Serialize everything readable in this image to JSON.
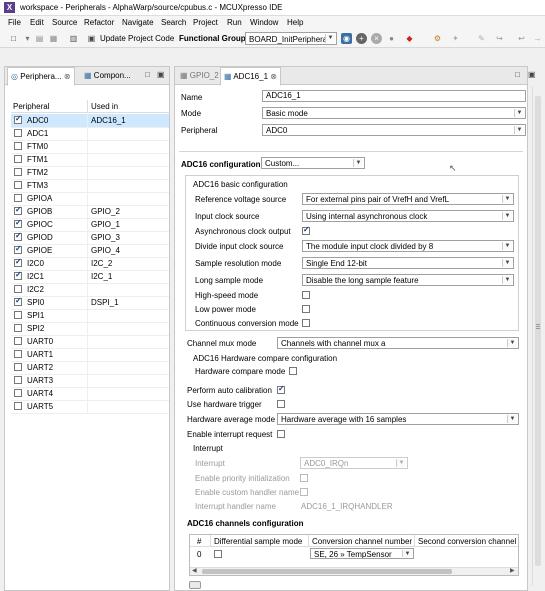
{
  "window": {
    "title": "workspace - Peripherals - AlphaWarp/source/cpubus.c - MCUXpresso IDE",
    "app_icon": "X"
  },
  "menu": [
    "File",
    "Edit",
    "Source",
    "Refactor",
    "Navigate",
    "Search",
    "Project",
    "Run",
    "Window",
    "Help"
  ],
  "toolbar": {
    "update_label": "Update Project Code",
    "group_label": "Functional Group",
    "group_value": "BOARD_InitPeripherals"
  },
  "left_tabs": {
    "peripherals": "Periphera...",
    "components": "Compon..."
  },
  "periph_table": {
    "headers": [
      "Peripheral",
      "Used in"
    ],
    "rows": [
      {
        "name": "ADC0",
        "used": "ADC16_1",
        "checked": true
      },
      {
        "name": "ADC1",
        "used": "",
        "checked": false
      },
      {
        "name": "FTM0",
        "used": "",
        "checked": false
      },
      {
        "name": "FTM1",
        "used": "",
        "checked": false
      },
      {
        "name": "FTM2",
        "used": "",
        "checked": false
      },
      {
        "name": "FTM3",
        "used": "",
        "checked": false
      },
      {
        "name": "GPIOA",
        "used": "",
        "checked": false
      },
      {
        "name": "GPIOB",
        "used": "GPIO_2",
        "checked": true
      },
      {
        "name": "GPIOC",
        "used": "GPIO_1",
        "checked": true
      },
      {
        "name": "GPIOD",
        "used": "GPIO_3",
        "checked": true
      },
      {
        "name": "GPIOE",
        "used": "GPIO_4",
        "checked": true
      },
      {
        "name": "I2C0",
        "used": "I2C_2",
        "checked": true
      },
      {
        "name": "I2C1",
        "used": "I2C_1",
        "checked": true
      },
      {
        "name": "I2C2",
        "used": "",
        "checked": false
      },
      {
        "name": "SPI0",
        "used": "DSPI_1",
        "checked": true
      },
      {
        "name": "SPI1",
        "used": "",
        "checked": false
      },
      {
        "name": "SPI2",
        "used": "",
        "checked": false
      },
      {
        "name": "UART0",
        "used": "",
        "checked": false
      },
      {
        "name": "UART1",
        "used": "",
        "checked": false
      },
      {
        "name": "UART2",
        "used": "",
        "checked": false
      },
      {
        "name": "UART3",
        "used": "",
        "checked": false
      },
      {
        "name": "UART4",
        "used": "",
        "checked": false
      },
      {
        "name": "UART5",
        "used": "",
        "checked": false
      }
    ]
  },
  "editor_tabs": {
    "gpio": "GPIO_2",
    "adc": "ADC16_1"
  },
  "form": {
    "name_label": "Name",
    "name_value": "ADC16_1",
    "mode_label": "Mode",
    "mode_value": "Basic mode",
    "periph_label": "Peripheral",
    "periph_value": "ADC0",
    "config_label": "ADC16 configuration",
    "config_value": "Custom...",
    "basic_title": "ADC16 basic configuration",
    "ref_label": "Reference voltage source",
    "ref_value": "For external pins pair of VrefH and VrefL",
    "clk_label": "Input clock source",
    "clk_value": "Using internal asynchronous clock",
    "async_label": "Asynchronous clock output",
    "div_label": "Divide input clock source",
    "div_value": "The module input clock divided by 8",
    "res_label": "Sample resolution mode",
    "res_value": "Single End 12-bit",
    "long_label": "Long sample mode",
    "long_value": "Disable the long sample feature",
    "hs_label": "High-speed mode",
    "lp_label": "Low power mode",
    "cont_label": "Continuous conversion mode",
    "mux_label": "Channel mux mode",
    "mux_value": "Channels with channel mux a",
    "hwcmp_title": "ADC16 Hardware compare configuration",
    "hwcmp_label": "Hardware compare mode",
    "autocal_label": "Perform auto calibration",
    "hwtrig_label": "Use hardware trigger",
    "hwavg_label": "Hardware average mode",
    "hwavg_value": "Hardware average with 16 samples",
    "irq_label": "Enable interrupt request",
    "int_title": "Interrupt",
    "int_label": "Interrupt",
    "int_value": "ADC0_IRQn",
    "prio_label": "Enable priority initialization",
    "custom_label": "Enable custom handler name",
    "handler_label": "Interrupt handler name",
    "handler_value": "ADC16_1_IRQHANDLER",
    "channels_title": "ADC16 channels configuration",
    "ch_headers": [
      "#",
      "Differential sample mode",
      "Conversion channel number",
      "Second conversion channel n"
    ],
    "ch_row": {
      "num": "0",
      "conv": "SE, 26 » TempSensor"
    }
  }
}
